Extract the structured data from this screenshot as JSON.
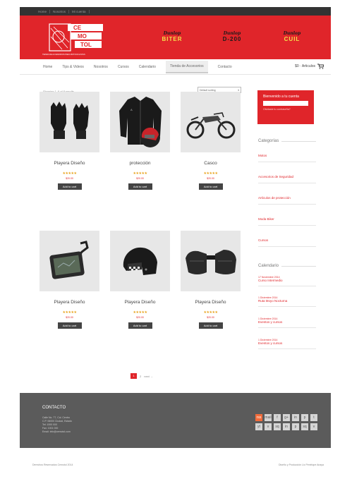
{
  "topbar": {
    "links": [
      "Home",
      "Nosotros",
      "Mi cuenta"
    ]
  },
  "header": {
    "logo_text": "CE-MO-TOL",
    "logo_tagline": "TIENDA DE ACCESORIOS PARA MOTOCICLISTAS",
    "brands": [
      {
        "top": "Dunlop",
        "bottom": "BITER"
      },
      {
        "top": "Dunlop",
        "bottom": "D-200"
      },
      {
        "top": "Dunlop",
        "bottom": "CUIL"
      }
    ]
  },
  "nav": {
    "items": [
      "Home",
      "Tips & Videos",
      "Nosotros",
      "Cursos",
      "Calendario",
      "Tienda de Accesorios",
      "Contacto"
    ],
    "cart_label": "$0 · Articulos"
  },
  "shop": {
    "showing_text": "Showing 1–6 of 8 results",
    "sort_value": "Default sorting",
    "products": [
      {
        "name": "Playera Diseño",
        "stars": "★★★★★",
        "price": "$20.00",
        "button": "Add to cart",
        "icon": "gloves-icon"
      },
      {
        "name": "protección",
        "stars": "★★★★★",
        "price": "$20.00",
        "button": "Add to cart",
        "icon": "jacket-icon"
      },
      {
        "name": "Casco",
        "stars": "★★★★★",
        "price": "$20.00",
        "button": "Add to cart",
        "icon": "motorcycle-icon"
      },
      {
        "name": "Playera Diseño",
        "stars": "★★★★★",
        "price": "$20.00",
        "button": "Add to cart",
        "icon": "gps-icon"
      },
      {
        "name": "Playera Diseño",
        "stars": "★★★★★",
        "price": "$20.00",
        "button": "Add to cart",
        "icon": "helmet-icon"
      },
      {
        "name": "Playera Diseño",
        "stars": "★★★★★",
        "price": "$20.00",
        "button": "Add to cart",
        "icon": "saddlebags-icon"
      }
    ],
    "pagination": {
      "current": "1",
      "next": "2",
      "next_label": "next →"
    }
  },
  "sidebar": {
    "welcome_title": "Bienvenido a tu cuenta",
    "welcome_sub": "Olvidaste tu contraseña?",
    "categories_heading": "Categorías",
    "categories": [
      "Motos",
      "Accesorios de Seguridad",
      "Artículos de protección",
      "Moda Biker",
      "Cursos"
    ],
    "calendar_heading": "Calendario",
    "events": [
      {
        "date": "17 Noviembre 2014",
        "title": "Curso Intermedio"
      },
      {
        "date": "1 Diciembre 2014",
        "title": "Ruta Moyo Nocturna"
      },
      {
        "date": "1 Diciembre 2014",
        "title": "Eventos y cursos"
      },
      {
        "date": "1 Diciembre 2014",
        "title": "Eventos y cursos"
      }
    ]
  },
  "footer": {
    "heading": "CONTACTO",
    "address_lines": [
      "Calle No. 77, Col. Centro",
      "C.P. 06000 Ciudad, Estado",
      "Tel: 1000 000",
      "Fax: 1001 000",
      "Email: info@cemotol.com"
    ],
    "social_icons": [
      "rss",
      "mail",
      "f",
      "g+",
      "in",
      "p",
      "t",
      "yt",
      "v",
      "sq",
      "in",
      "p",
      "sq",
      "v"
    ],
    "copyright": "Derechos Reservados Cemotol 2014",
    "credit": "Diseño y Producción Lic Penélope Anaya"
  },
  "colors": {
    "accent": "#e0252a",
    "footer_bg": "#5b5b5b",
    "topbar_bg": "#333333",
    "stars": "#e8a21a"
  }
}
